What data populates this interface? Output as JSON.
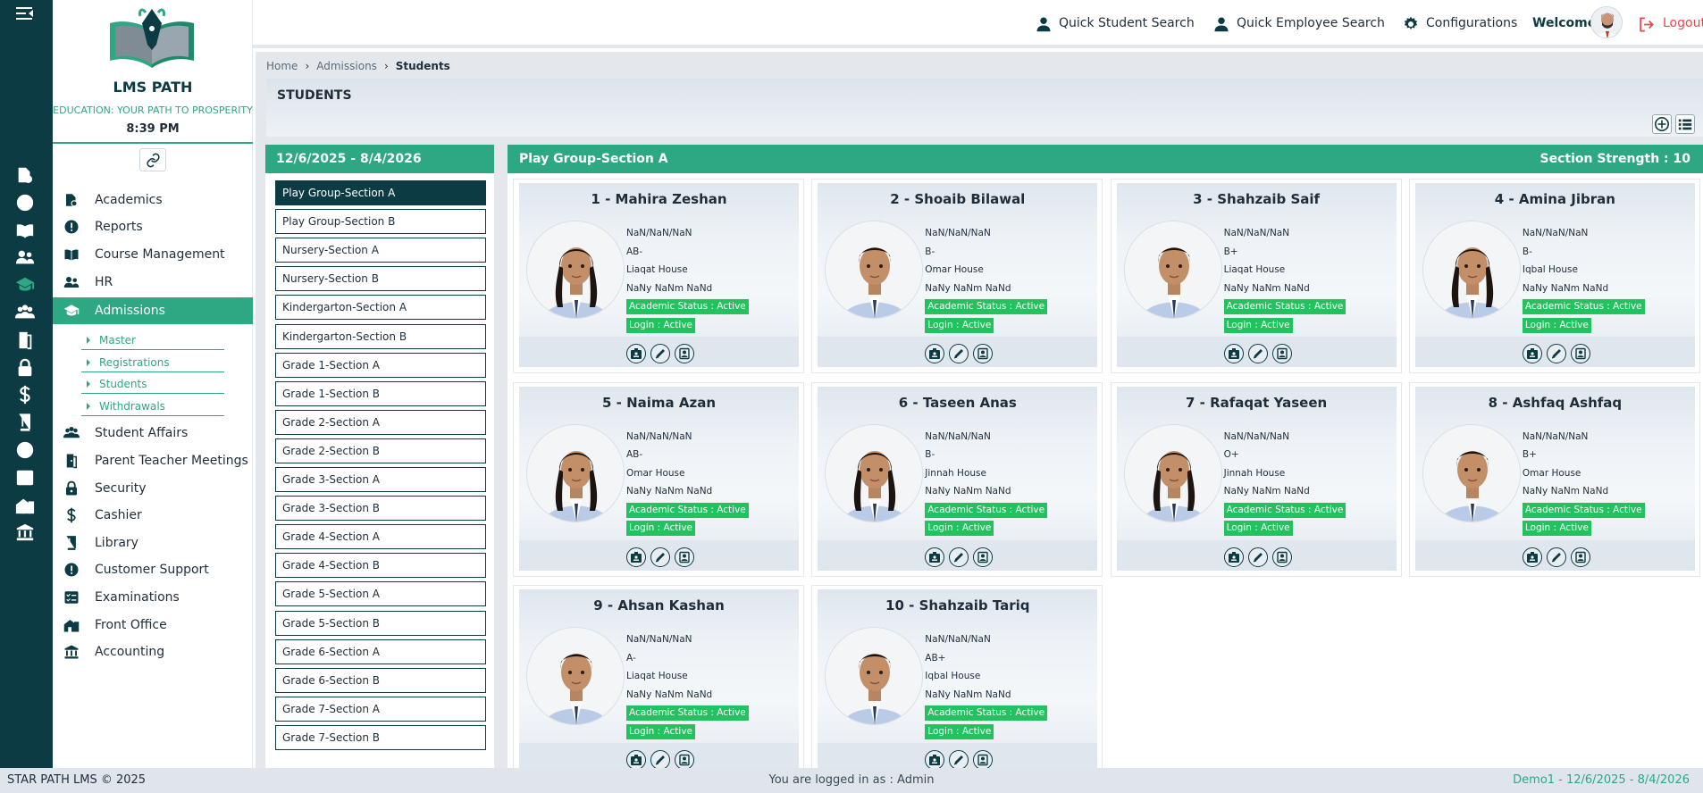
{
  "app": {
    "brand": "LMS PATH",
    "tagline": "EDUCATION: YOUR PATH TO PROSPERITY",
    "time": "8:39 PM"
  },
  "topbar": {
    "quick_student_search": "Quick Student Search",
    "quick_employee_search": "Quick Employee Search",
    "configurations": "Configurations",
    "welcome": "Welcome",
    "logout": "Logout"
  },
  "sidebar": {
    "items": [
      {
        "label": "Academics",
        "icon": "academics-icon"
      },
      {
        "label": "Reports",
        "icon": "alert-circle-icon"
      },
      {
        "label": "Course Management",
        "icon": "book-open-icon"
      },
      {
        "label": "HR",
        "icon": "people-icon"
      },
      {
        "label": "Admissions",
        "icon": "graduation-cap-icon"
      },
      {
        "label": "Student Affairs",
        "icon": "group-icon"
      },
      {
        "label": "Parent Teacher Meetings",
        "icon": "door-icon"
      },
      {
        "label": "Security",
        "icon": "lock-icon"
      },
      {
        "label": "Cashier",
        "icon": "dollar-icon"
      },
      {
        "label": "Library",
        "icon": "book-icon"
      },
      {
        "label": "Customer Support",
        "icon": "alert-circle-icon"
      },
      {
        "label": "Examinations",
        "icon": "checklist-icon"
      },
      {
        "label": "Front Office",
        "icon": "building-icon"
      },
      {
        "label": "Accounting",
        "icon": "bank-icon"
      }
    ],
    "admissions_sub": [
      "Master",
      "Registrations",
      "Students",
      "Withdrawals"
    ]
  },
  "breadcrumb": {
    "home": "Home",
    "admissions": "Admissions",
    "current": "Students"
  },
  "page": {
    "title": "STUDENTS"
  },
  "sections_panel": {
    "date_range": "12/6/2025 - 8/4/2026",
    "sections": [
      "Play Group-Section A",
      "Play Group-Section B",
      "Nursery-Section A",
      "Nursery-Section B",
      "Kindergarton-Section A",
      "Kindergarton-Section B",
      "Grade 1-Section A",
      "Grade 1-Section B",
      "Grade 2-Section A",
      "Grade 2-Section B",
      "Grade 3-Section A",
      "Grade 3-Section B",
      "Grade 4-Section A",
      "Grade 4-Section B",
      "Grade 5-Section A",
      "Grade 5-Section B",
      "Grade 6-Section A",
      "Grade 6-Section B",
      "Grade 7-Section A",
      "Grade 7-Section B"
    ],
    "selected_index": 0
  },
  "students_panel": {
    "section_title": "Play Group-Section A",
    "strength_label": "Section Strength : 10",
    "students": [
      {
        "name": "1 - Mahira Zeshan",
        "dob": "NaN/NaN/NaN",
        "blood": "AB-",
        "house": "Liaqat House",
        "age": "NaNy NaNm NaNd",
        "academic_status": "Academic Status : Active",
        "login": "Login : Active",
        "gender": "female"
      },
      {
        "name": "2 - Shoaib Bilawal",
        "dob": "NaN/NaN/NaN",
        "blood": "B-",
        "house": "Omar House",
        "age": "NaNy NaNm NaNd",
        "academic_status": "Academic Status : Active",
        "login": "Login : Active",
        "gender": "male"
      },
      {
        "name": "3 - Shahzaib Saif",
        "dob": "NaN/NaN/NaN",
        "blood": "B+",
        "house": "Liaqat House",
        "age": "NaNy NaNm NaNd",
        "academic_status": "Academic Status : Active",
        "login": "Login : Active",
        "gender": "male"
      },
      {
        "name": "4 - Amina Jibran",
        "dob": "NaN/NaN/NaN",
        "blood": "B-",
        "house": "Iqbal House",
        "age": "NaNy NaNm NaNd",
        "academic_status": "Academic Status : Active",
        "login": "Login : Active",
        "gender": "female"
      },
      {
        "name": "5 - Naima Azan",
        "dob": "NaN/NaN/NaN",
        "blood": "AB-",
        "house": "Omar House",
        "age": "NaNy NaNm NaNd",
        "academic_status": "Academic Status : Active",
        "login": "Login : Active",
        "gender": "female"
      },
      {
        "name": "6 - Taseen Anas",
        "dob": "NaN/NaN/NaN",
        "blood": "B-",
        "house": "Jinnah House",
        "age": "NaNy NaNm NaNd",
        "academic_status": "Academic Status : Active",
        "login": "Login : Active",
        "gender": "female"
      },
      {
        "name": "7 - Rafaqat Yaseen",
        "dob": "NaN/NaN/NaN",
        "blood": "O+",
        "house": "Jinnah House",
        "age": "NaNy NaNm NaNd",
        "academic_status": "Academic Status : Active",
        "login": "Login : Active",
        "gender": "female"
      },
      {
        "name": "8 - Ashfaq Ashfaq",
        "dob": "NaN/NaN/NaN",
        "blood": "B+",
        "house": "Omar House",
        "age": "NaNy NaNm NaNd",
        "academic_status": "Academic Status : Active",
        "login": "Login : Active",
        "gender": "male"
      },
      {
        "name": "9 - Ahsan Kashan",
        "dob": "NaN/NaN/NaN",
        "blood": "A-",
        "house": "Liaqat House",
        "age": "NaNy NaNm NaNd",
        "academic_status": "Academic Status : Active",
        "login": "Login : Active",
        "gender": "male"
      },
      {
        "name": "10 - Shahzaib Tariq",
        "dob": "NaN/NaN/NaN",
        "blood": "AB+",
        "house": "Iqbal House",
        "age": "NaNy NaNm NaNd",
        "academic_status": "Academic Status : Active",
        "login": "Login : Active",
        "gender": "male"
      }
    ]
  },
  "footer": {
    "copyright": "STAR PATH LMS © 2025",
    "logged_in": "You are logged in as : Admin",
    "session": "Demo1 -  12/6/2025 - 8/4/2026"
  },
  "colors": {
    "primary_dark": "#0d3b44",
    "accent_green": "#2ea783",
    "badge_green": "#22c35e",
    "logout_red": "#e5484d"
  }
}
